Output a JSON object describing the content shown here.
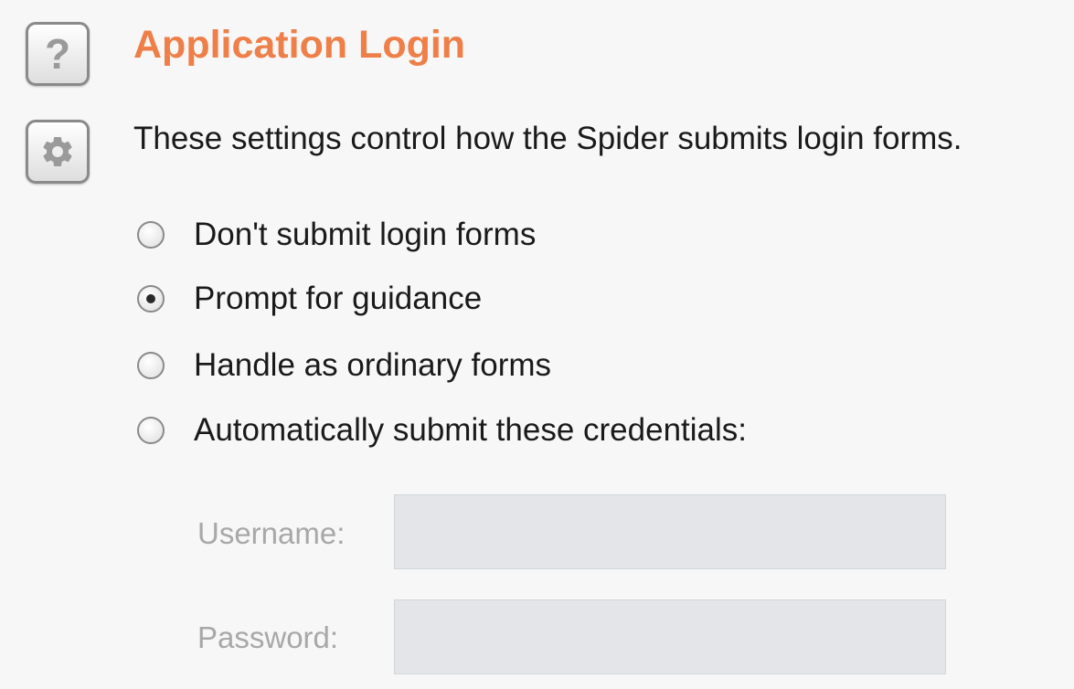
{
  "header": {
    "title": "Application Login",
    "description": "These settings control how the Spider submits login forms."
  },
  "icons": {
    "help": "help-icon",
    "settings": "gear-icon",
    "help_glyph": "?"
  },
  "colors": {
    "title": "#ee7f49",
    "text": "#1a1a1a",
    "disabled_label": "#a8a8a8",
    "disabled_field": "#e3e5e8"
  },
  "login_options": {
    "selected": "Prompt for guidance",
    "items": [
      {
        "label": "Don't submit login forms",
        "checked": false
      },
      {
        "label": "Prompt for guidance",
        "checked": true
      },
      {
        "label": "Handle as ordinary forms",
        "checked": false
      },
      {
        "label": "Automatically submit these credentials:",
        "checked": false
      }
    ]
  },
  "credentials": {
    "username_label": "Username:",
    "username_value": "",
    "password_label": "Password:",
    "password_value": ""
  }
}
